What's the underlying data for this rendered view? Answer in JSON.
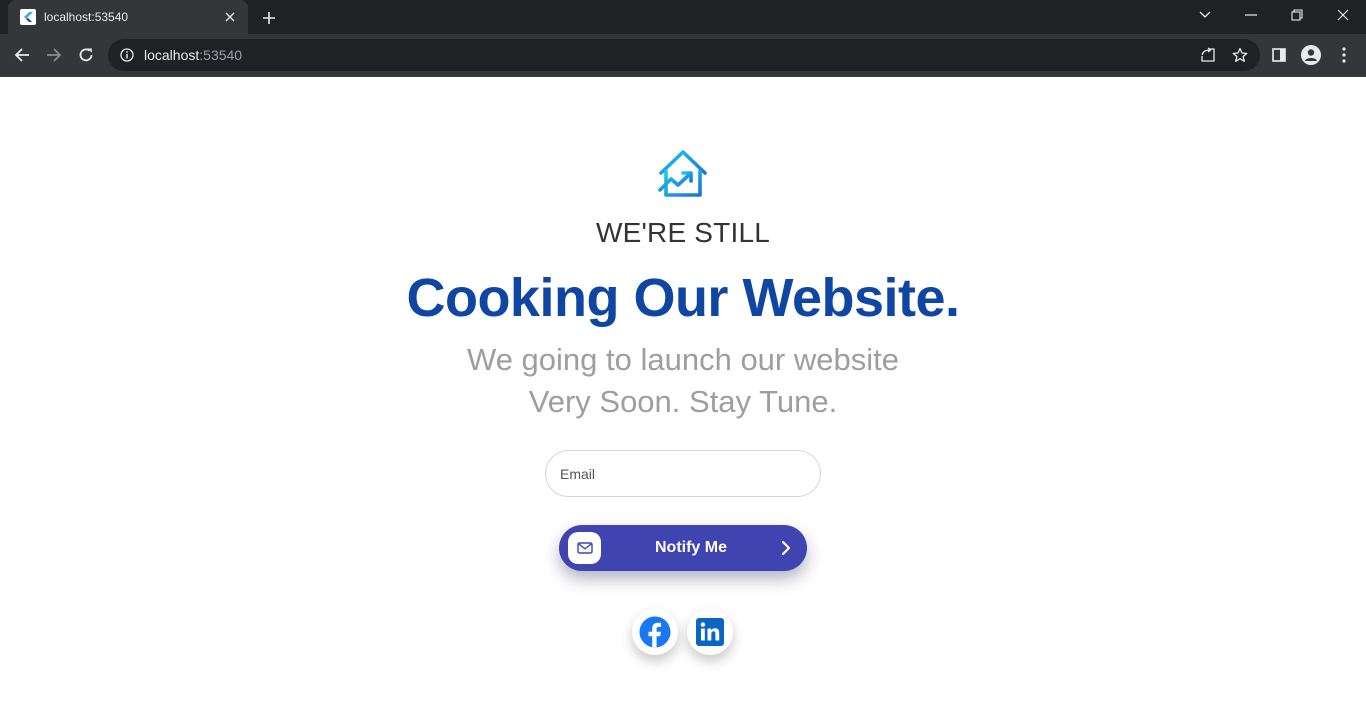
{
  "browser": {
    "tab_title": "localhost:53540",
    "url_host": "localhost",
    "url_port": ":53540"
  },
  "page": {
    "eyebrow": "WE'RE STILL",
    "headline": "Cooking Our Website.",
    "subline_1": "We going to launch our website",
    "subline_2": "Very Soon. Stay Tune.",
    "email_placeholder": "Email",
    "notify_label": "Notify Me"
  },
  "icons": {
    "logo": "house-trend-up-icon",
    "notify_left": "mail-icon",
    "notify_right": "chevron-right-icon",
    "social": [
      "facebook-icon",
      "linkedin-icon"
    ]
  },
  "colors": {
    "headline": "#0f45a3",
    "button": "#3f44b0",
    "logo_gradient_start": "#1ec8f0",
    "logo_gradient_end": "#1876d8",
    "facebook": "#1877f2",
    "linkedin": "#0a66c2"
  }
}
